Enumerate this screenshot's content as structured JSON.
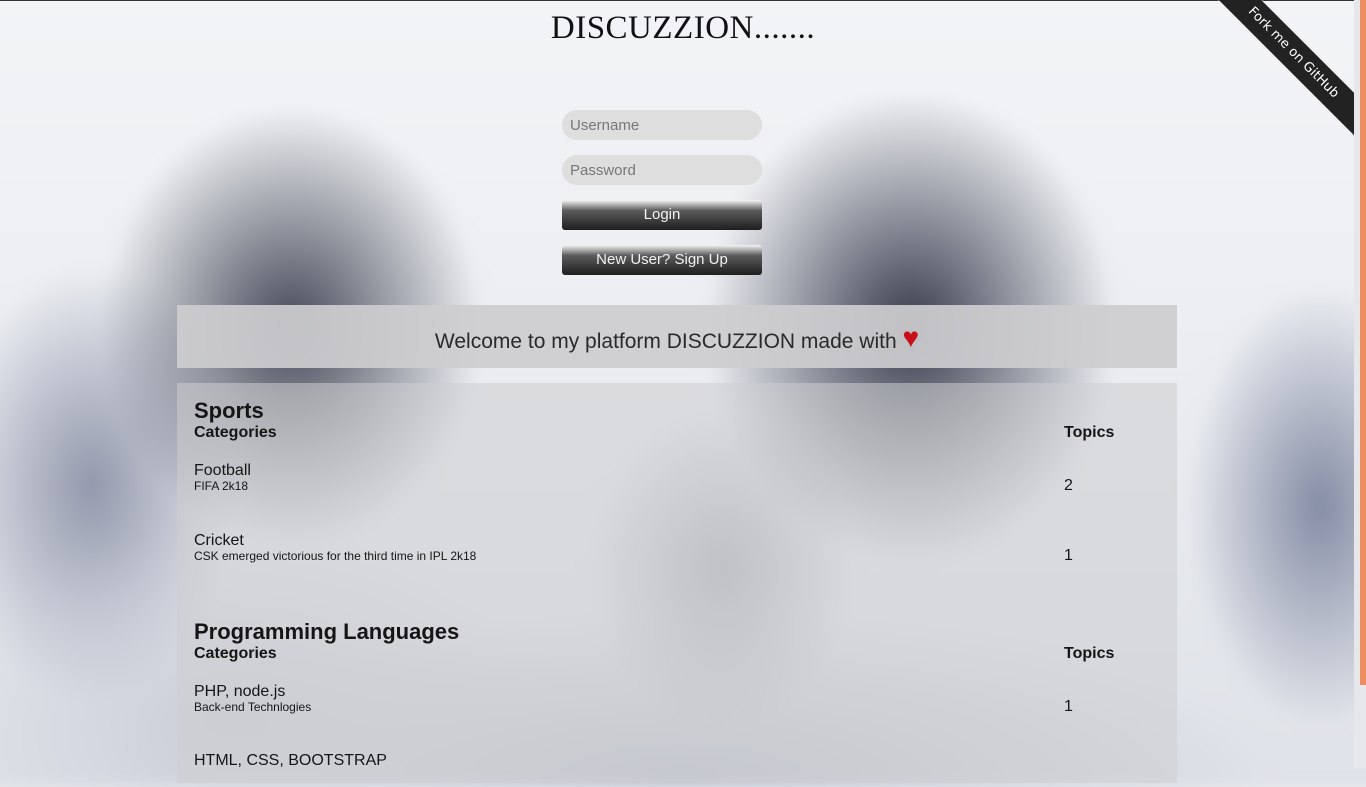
{
  "site_title": "DISCUZZION.......",
  "login": {
    "username_placeholder": "Username",
    "password_placeholder": "Password",
    "login_label": "Login",
    "signup_label": "New User? Sign Up"
  },
  "ribbon_label": "Fork me on GitHub",
  "welcome": {
    "text": "Welcome to my platform DISCUZZION made with",
    "heart": "♥"
  },
  "sections": [
    {
      "title": "Sports",
      "categories_header": "Categories",
      "topics_header": "Topics",
      "categories": [
        {
          "name": "Football",
          "description": "FIFA 2k18",
          "topics": "2"
        },
        {
          "name": "Cricket",
          "description": "CSK emerged victorious for the third time in IPL 2k18",
          "topics": "1"
        }
      ]
    },
    {
      "title": "Programming Languages",
      "categories_header": "Categories",
      "topics_header": "Topics",
      "categories": [
        {
          "name": "PHP, node.js",
          "description": "Back-end Technlogies",
          "topics": "1"
        },
        {
          "name": "HTML, CSS, BOOTSTRAP",
          "description": "",
          "topics": ""
        }
      ]
    }
  ],
  "colors": {
    "accent_scrollbar": "#ee8d62",
    "heart": "#c8101a"
  }
}
